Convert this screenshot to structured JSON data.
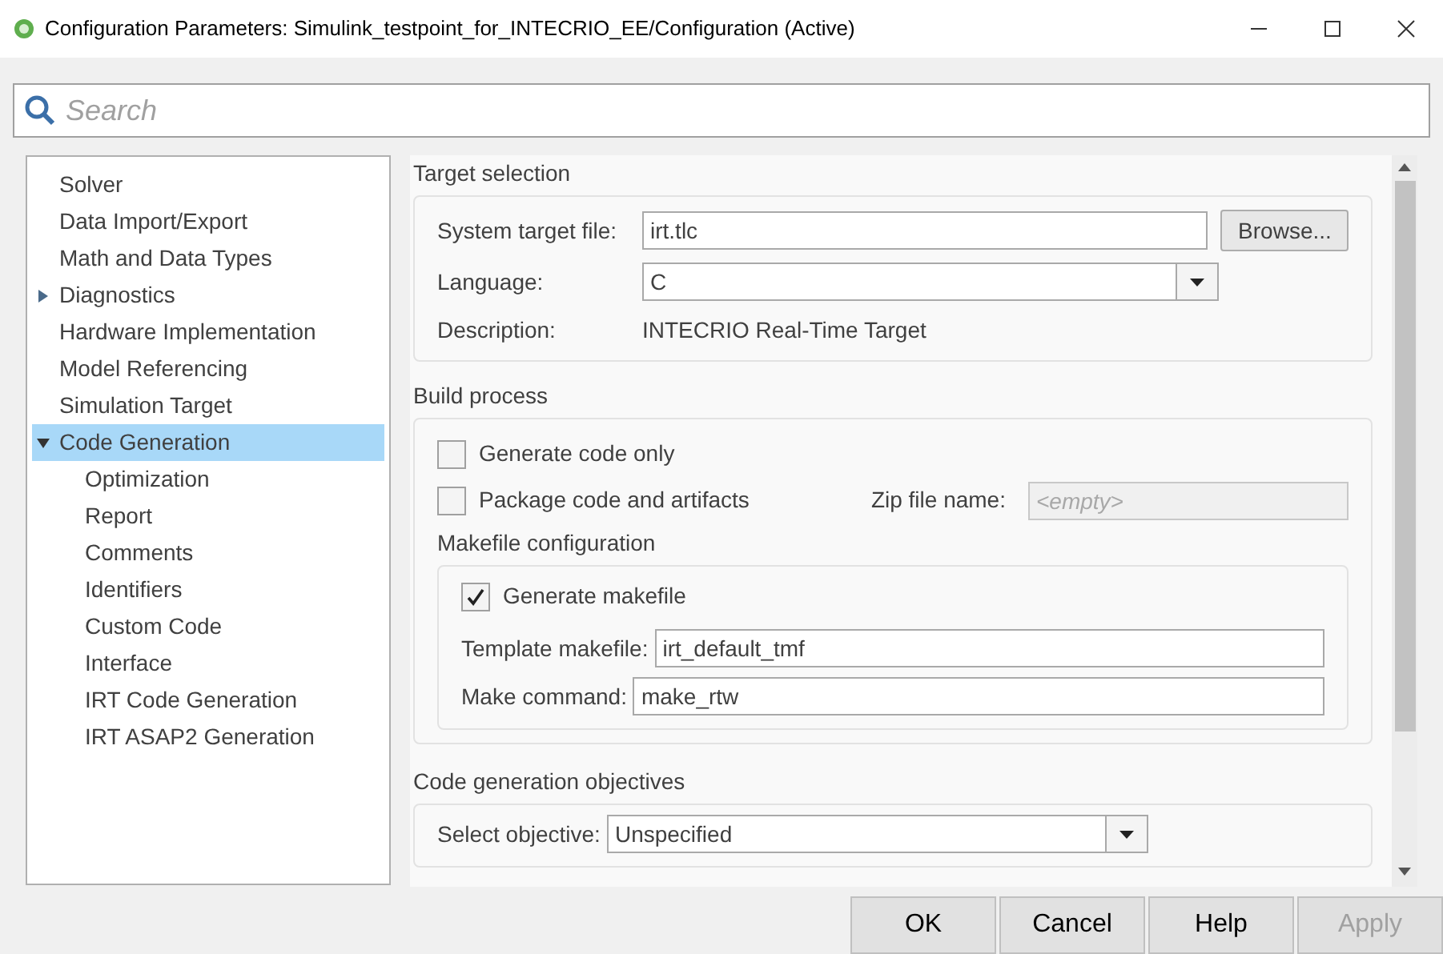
{
  "window": {
    "title": "Configuration Parameters: Simulink_testpoint_for_INTECRIO_EE/Configuration (Active)"
  },
  "search": {
    "placeholder": "Search"
  },
  "tree": {
    "items": [
      {
        "label": "Solver",
        "kind": "leaf",
        "selected": false
      },
      {
        "label": "Data Import/Export",
        "kind": "leaf",
        "selected": false
      },
      {
        "label": "Math and Data Types",
        "kind": "leaf",
        "selected": false
      },
      {
        "label": "Diagnostics",
        "kind": "group",
        "expanded": false,
        "selected": false
      },
      {
        "label": "Hardware Implementation",
        "kind": "leaf",
        "selected": false
      },
      {
        "label": "Model Referencing",
        "kind": "leaf",
        "selected": false
      },
      {
        "label": "Simulation Target",
        "kind": "leaf",
        "selected": false
      },
      {
        "label": "Code Generation",
        "kind": "group",
        "expanded": true,
        "selected": true,
        "children": [
          {
            "label": "Optimization",
            "kind": "leaf",
            "selected": false
          },
          {
            "label": "Report",
            "kind": "leaf",
            "selected": false
          },
          {
            "label": "Comments",
            "kind": "leaf",
            "selected": false
          },
          {
            "label": "Identifiers",
            "kind": "leaf",
            "selected": false
          },
          {
            "label": "Custom Code",
            "kind": "leaf",
            "selected": false
          },
          {
            "label": "Interface",
            "kind": "leaf",
            "selected": false
          },
          {
            "label": "IRT Code Generation",
            "kind": "leaf",
            "selected": false
          },
          {
            "label": "IRT ASAP2 Generation",
            "kind": "leaf",
            "selected": false
          }
        ]
      }
    ]
  },
  "target_selection": {
    "title": "Target selection",
    "system_target_file": {
      "label": "System target file:",
      "value": "irt.tlc"
    },
    "browse_button": "Browse...",
    "language": {
      "label": "Language:",
      "value": "C"
    },
    "description": {
      "label": "Description:",
      "value": "INTECRIO Real-Time Target"
    }
  },
  "build_process": {
    "title": "Build process",
    "generate_code_only": {
      "label": "Generate code only",
      "checked": false
    },
    "package_code": {
      "label": "Package code and artifacts",
      "checked": false
    },
    "zip_file_name": {
      "label": "Zip file name:",
      "placeholder": "<empty>",
      "disabled": true
    },
    "makefile_configuration": {
      "title": "Makefile configuration",
      "generate_makefile": {
        "label": "Generate makefile",
        "checked": true
      },
      "template_makefile": {
        "label": "Template makefile:",
        "value": "irt_default_tmf"
      },
      "make_command": {
        "label": "Make command:",
        "value": "make_rtw"
      }
    }
  },
  "code_generation_objectives": {
    "title": "Code generation objectives",
    "select_objective": {
      "label": "Select objective:",
      "value": "Unspecified"
    }
  },
  "buttons": [
    {
      "label": "OK",
      "disabled": false
    },
    {
      "label": "Cancel",
      "disabled": false
    },
    {
      "label": "Help",
      "disabled": false
    },
    {
      "label": "Apply",
      "disabled": true
    }
  ]
}
